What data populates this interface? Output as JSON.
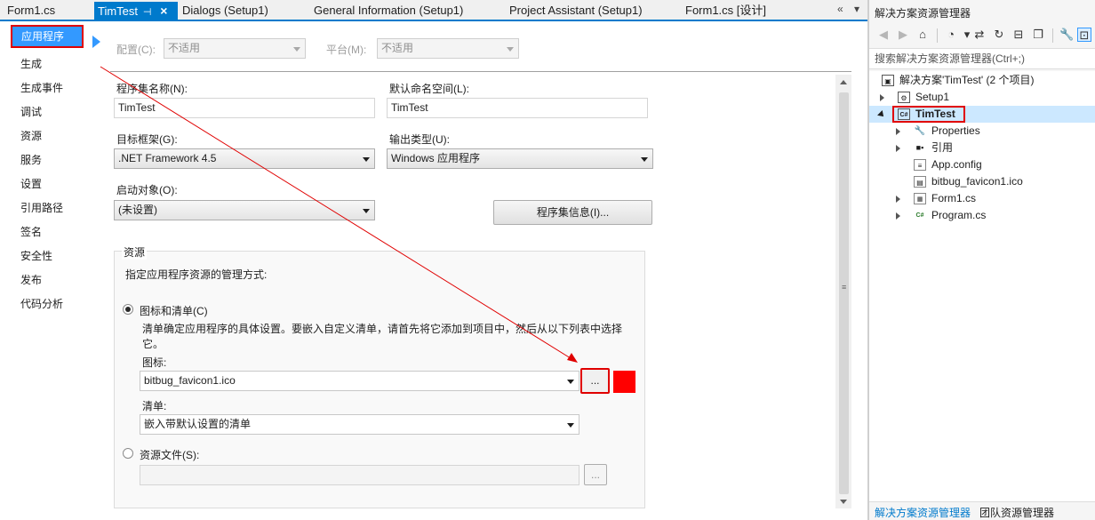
{
  "tabs": [
    {
      "label": "Form1.cs",
      "active": false
    },
    {
      "label": "TimTest",
      "active": true
    },
    {
      "label": "Dialogs (Setup1)",
      "active": false
    },
    {
      "label": "General Information (Setup1)",
      "active": false
    },
    {
      "label": "Project Assistant (Setup1)",
      "active": false
    },
    {
      "label": "Form1.cs [设计]",
      "active": false
    }
  ],
  "tab_icons": {
    "pin": "pin-icon",
    "close": "close-icon",
    "overflow": "«",
    "dropdown": "▾"
  },
  "nav": {
    "items": [
      "应用程序",
      "生成",
      "生成事件",
      "调试",
      "资源",
      "服务",
      "设置",
      "引用路径",
      "签名",
      "安全性",
      "发布",
      "代码分析"
    ],
    "selected_index": 0
  },
  "config_row": {
    "config_label": "配置(C):",
    "config_value": "不适用",
    "platform_label": "平台(M):",
    "platform_value": "不适用"
  },
  "app": {
    "assembly_name_label": "程序集名称(N):",
    "assembly_name": "TimTest",
    "default_ns_label": "默认命名空间(L):",
    "default_ns": "TimTest",
    "target_fw_label": "目标框架(G):",
    "target_fw": ".NET Framework 4.5",
    "output_type_label": "输出类型(U):",
    "output_type": "Windows 应用程序",
    "startup_label": "启动对象(O):",
    "startup_value": "(未设置)",
    "assembly_info_button": "程序集信息(I)..."
  },
  "resources": {
    "group_title": "资源",
    "description": "指定应用程序资源的管理方式:",
    "icon_manifest_option": "图标和清单(C)",
    "icon_manifest_desc_1": "清单确定应用程序的具体设置。要嵌入自定义清单，请首先将它添加到项目中，然后从以下列表中选择",
    "icon_manifest_desc_2": "它。",
    "icon_label": "图标:",
    "icon_value": "bitbug_favicon1.ico",
    "browse_button": "...",
    "manifest_label": "清单:",
    "manifest_value": "嵌入带默认设置的清单",
    "resource_file_option": "资源文件(S):",
    "resource_file_value": "",
    "resource_browse_button": "..."
  },
  "solution_explorer": {
    "title": "解决方案资源管理器",
    "search_placeholder": "搜索解决方案资源管理器(Ctrl+;)",
    "tree": [
      {
        "label": "解决方案'TimTest' (2 个项目)",
        "level": 0,
        "icon": "solution-icon",
        "toggle": "none"
      },
      {
        "label": "Setup1",
        "level": 1,
        "icon": "setup-project-icon",
        "toggle": "collapsed"
      },
      {
        "label": "TimTest",
        "level": 1,
        "icon": "csharp-project-icon",
        "toggle": "expanded",
        "highlighted": true
      },
      {
        "label": "Properties",
        "level": 2,
        "icon": "wrench-icon",
        "toggle": "collapsed"
      },
      {
        "label": "引用",
        "level": 2,
        "icon": "references-icon",
        "toggle": "collapsed"
      },
      {
        "label": "App.config",
        "level": 2,
        "icon": "config-file-icon",
        "toggle": "none"
      },
      {
        "label": "bitbug_favicon1.ico",
        "level": 2,
        "icon": "image-file-icon",
        "toggle": "none"
      },
      {
        "label": "Form1.cs",
        "level": 2,
        "icon": "csharp-file-icon",
        "toggle": "collapsed"
      },
      {
        "label": "Program.cs",
        "level": 2,
        "icon": "csharp-file-icon",
        "toggle": "collapsed"
      }
    ],
    "bottom_tabs": [
      "解决方案资源管理器",
      "团队资源管理器"
    ]
  },
  "colors": {
    "accent": "#007acc",
    "nav_selected": "#3399ff",
    "annotation_red": "#e00000"
  }
}
